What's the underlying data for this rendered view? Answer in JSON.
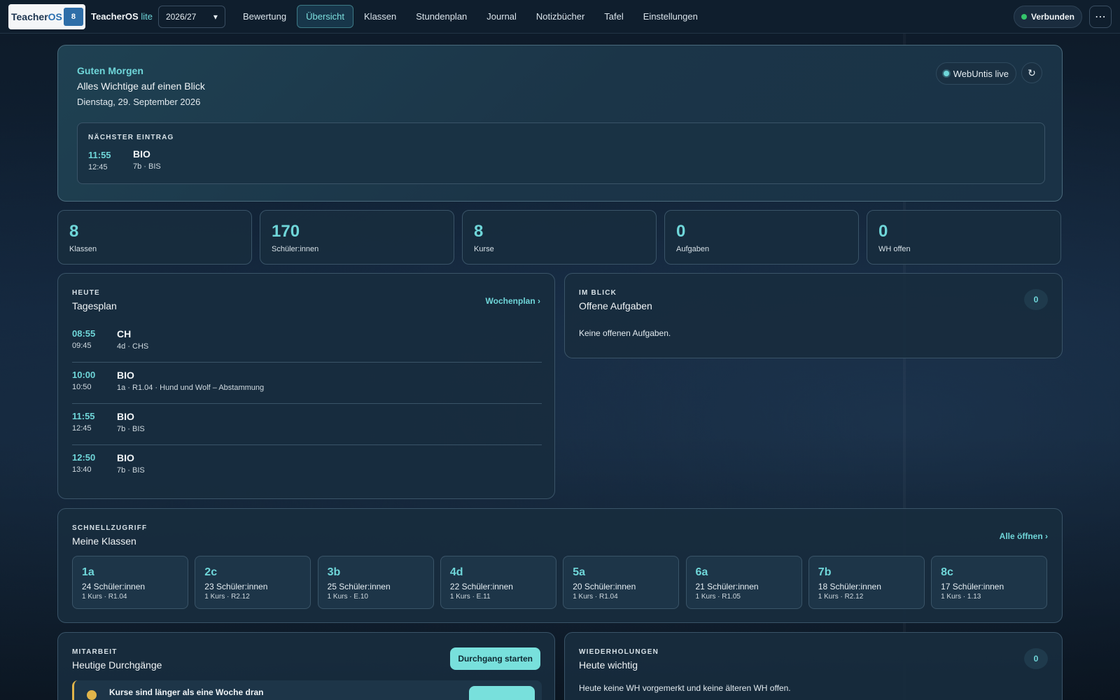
{
  "header": {
    "logo_text_a": "Teacher",
    "logo_text_b": "OS",
    "logo_badge": "8",
    "app_name": "TeacherOS",
    "app_suffix": "lite",
    "year": "2026/27",
    "nav": [
      {
        "label": "Bewertung"
      },
      {
        "label": "Übersicht"
      },
      {
        "label": "Klassen"
      },
      {
        "label": "Stundenplan"
      },
      {
        "label": "Journal"
      },
      {
        "label": "Notizbücher"
      },
      {
        "label": "Tafel"
      },
      {
        "label": "Einstellungen"
      }
    ],
    "active_nav": "Übersicht",
    "connection": "Verbunden",
    "more": "⋯"
  },
  "hero": {
    "greeting": "Guten Morgen",
    "title": "Alles Wichtige auf einen Blick",
    "date": "Dienstag, 29. September 2026",
    "live_label": "WebUntis live",
    "refresh_icon": "↻",
    "next": {
      "label": "NÄCHSTER EINTRAG",
      "start": "11:55",
      "end": "12:45",
      "subject": "BIO",
      "meta": "7b · BIS"
    }
  },
  "stats": [
    {
      "value": "8",
      "label": "Klassen"
    },
    {
      "value": "170",
      "label": "Schüler:innen"
    },
    {
      "value": "8",
      "label": "Kurse"
    },
    {
      "value": "0",
      "label": "Aufgaben"
    },
    {
      "value": "0",
      "label": "WH offen"
    }
  ],
  "today": {
    "caption": "HEUTE",
    "title": "Tagesplan",
    "link": "Wochenplan ›",
    "lessons": [
      {
        "start": "08:55",
        "end": "09:45",
        "subject": "CH",
        "meta": "4d · CHS"
      },
      {
        "start": "10:00",
        "end": "10:50",
        "subject": "BIO",
        "meta": "1a · R1.04 · Hund und Wolf – Abstammung"
      },
      {
        "start": "11:55",
        "end": "12:45",
        "subject": "BIO",
        "meta": "7b · BIS"
      },
      {
        "start": "12:50",
        "end": "13:40",
        "subject": "BIO",
        "meta": "7b · BIS"
      }
    ]
  },
  "tasks": {
    "caption": "IM BLICK",
    "title": "Offene Aufgaben",
    "count": "0",
    "empty": "Keine offenen Aufgaben."
  },
  "classes": {
    "caption": "SCHNELLZUGRIFF",
    "title": "Meine Klassen",
    "link": "Alle öffnen ›",
    "items": [
      {
        "name": "1a",
        "count": "24 Schüler:innen",
        "meta": "1 Kurs · R1.04"
      },
      {
        "name": "2c",
        "count": "23 Schüler:innen",
        "meta": "1 Kurs · R2.12"
      },
      {
        "name": "3b",
        "count": "25 Schüler:innen",
        "meta": "1 Kurs · E.10"
      },
      {
        "name": "4d",
        "count": "22 Schüler:innen",
        "meta": "1 Kurs · E.11"
      },
      {
        "name": "5a",
        "count": "20 Schüler:innen",
        "meta": "1 Kurs · R1.04"
      },
      {
        "name": "6a",
        "count": "21 Schüler:innen",
        "meta": "1 Kurs · R1.05"
      },
      {
        "name": "7b",
        "count": "18 Schüler:innen",
        "meta": "1 Kurs · R2.12"
      },
      {
        "name": "8c",
        "count": "17 Schüler:innen",
        "meta": "1 Kurs · 1.13"
      }
    ]
  },
  "mitarbeit": {
    "caption": "MITARBEIT",
    "title": "Heutige Durchgänge",
    "button": "Durchgang starten",
    "warning": "Kurse sind länger als eine Woche dran"
  },
  "wh": {
    "caption": "WIEDERHOLUNGEN",
    "title": "Heute wichtig",
    "count": "0",
    "text": "Heute keine WH vorgemerkt und keine älteren WH offen."
  },
  "colors": {
    "accent": "#6fd6d9",
    "status_ok": "#34c46b",
    "warning": "#e0b44a"
  }
}
